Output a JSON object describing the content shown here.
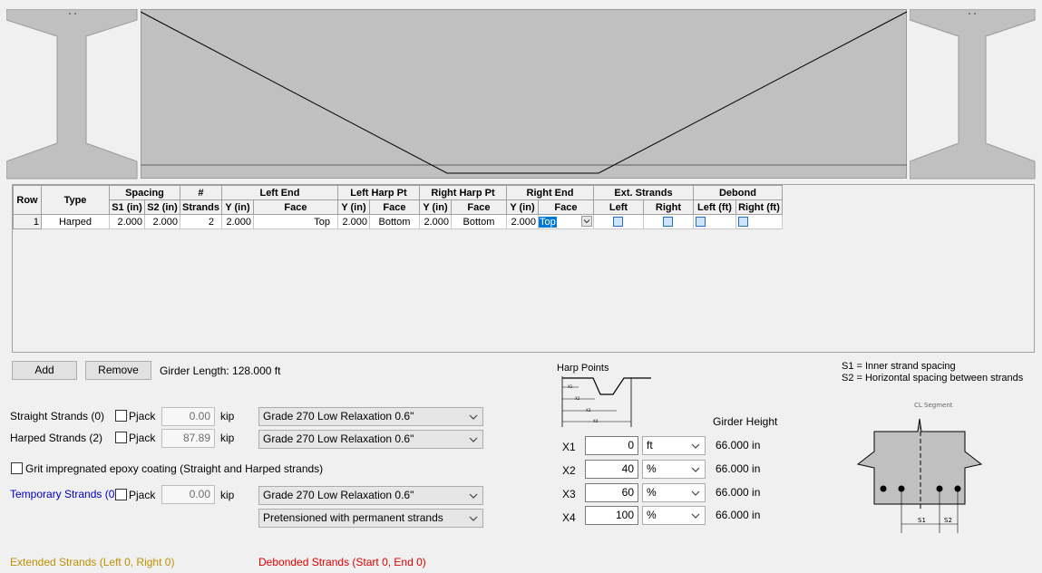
{
  "grid": {
    "headers": {
      "row": "Row",
      "type": "Type",
      "spacing": "Spacing",
      "s1": "S1 (in)",
      "s2": "S2 (in)",
      "num": "#",
      "strands": "Strands",
      "left_end": "Left End",
      "left_harp": "Left Harp Pt",
      "right_harp": "Right Harp Pt",
      "right_end": "Right End",
      "y_in": "Y (in)",
      "face": "Face",
      "ext": "Ext. Strands",
      "left": "Left",
      "right": "Right",
      "debond": "Debond",
      "left_ft": "Left (ft)",
      "right_ft": "Right (ft)"
    },
    "rows": [
      {
        "row": "1",
        "type": "Harped",
        "s1": "2.000",
        "s2": "2.000",
        "strands": "2",
        "left_end_y": "2.000",
        "left_end_face": "Top",
        "left_harp_y": "2.000",
        "left_harp_face": "Bottom",
        "right_harp_y": "2.000",
        "right_harp_face": "Bottom",
        "right_end_y": "2.000",
        "right_end_face": "Top"
      }
    ]
  },
  "buttons": {
    "add": "Add",
    "remove": "Remove"
  },
  "girder_length": "Girder Length: 128.000 ft",
  "strands": {
    "straight_label": "Straight Strands (0)",
    "harped_label": "Harped Strands (2)",
    "temporary_label": "Temporary Strands (0)",
    "pjack": "Pjack",
    "straight_force": "0.00",
    "harped_force": "87.89",
    "temporary_force": "0.00",
    "unit": "kip",
    "straight_grade": "Grade 270 Low Relaxation 0.6\"",
    "harped_grade": "Grade 270 Low Relaxation 0.6\"",
    "temporary_grade": "Grade 270 Low Relaxation 0.6\"",
    "temporary_type": "Pretensioned with permanent strands",
    "grit_label": "Grit impregnated epoxy coating (Straight and Harped strands)"
  },
  "harp": {
    "title": "Harp Points",
    "girder_height_label": "Girder Height",
    "points": [
      {
        "label": "X1",
        "value": "0",
        "unit": "ft",
        "height": "66.000 in"
      },
      {
        "label": "X2",
        "value": "40",
        "unit": "%",
        "height": "66.000 in"
      },
      {
        "label": "X3",
        "value": "60",
        "unit": "%",
        "height": "66.000 in"
      },
      {
        "label": "X4",
        "value": "100",
        "unit": "%",
        "height": "66.000 in"
      }
    ],
    "sketch_labels": [
      "X1",
      "X2",
      "X3",
      "X4"
    ]
  },
  "legend": {
    "s1": "S1 = Inner strand spacing",
    "s2": "S2 = Horizontal spacing between strands",
    "cl": "CL Segment",
    "s1_short": "S1",
    "s2_short": "S2"
  },
  "status": {
    "extended": "Extended Strands (Left 0, Right 0)",
    "debonded": "Debonded Strands (Start 0, End 0)"
  },
  "colors": {
    "girder_fill": "#c0c0c0",
    "temporary_blue": "#0000c0",
    "extended_gold": "#c09000",
    "debonded_red": "#e00000",
    "selection_blue": "#0078d7"
  }
}
